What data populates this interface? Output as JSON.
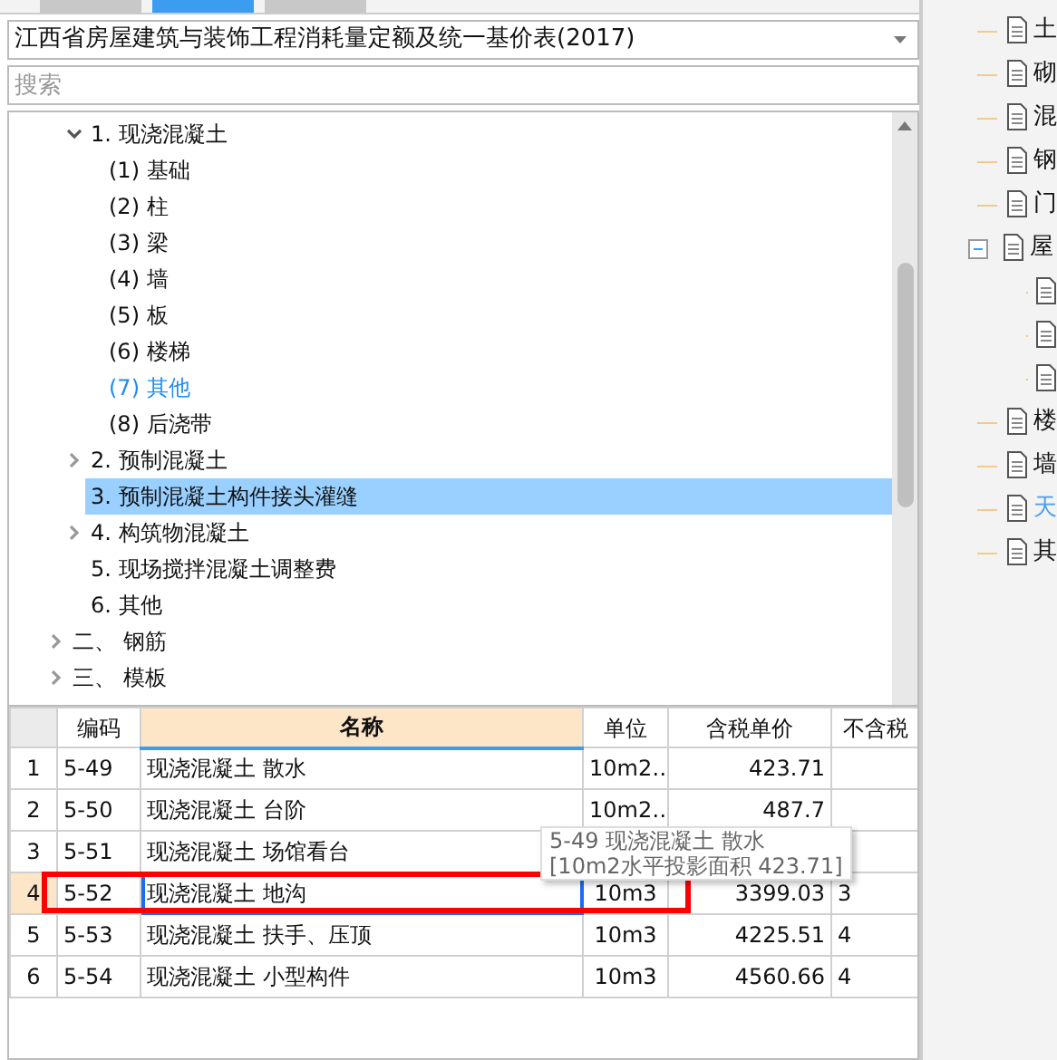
{
  "tabs": [
    {
      "selected": false
    },
    {
      "selected": true
    },
    {
      "selected": false
    }
  ],
  "library_select": {
    "value": "江西省房屋建筑与装饰工程消耗量定额及统一基价表(2017)"
  },
  "search": {
    "placeholder": "搜索"
  },
  "tree": {
    "items": [
      {
        "children": [
          {
            "label": "1. 现浇混凝土",
            "expanded": true,
            "selected": false,
            "active": false,
            "children": [
              {
                "label": "(1) 基础",
                "selected": false,
                "active": false
              },
              {
                "label": "(2) 柱",
                "selected": false,
                "active": false
              },
              {
                "label": "(3) 梁",
                "selected": false,
                "active": false
              },
              {
                "label": "(4) 墙",
                "selected": false,
                "active": false
              },
              {
                "label": "(5) 板",
                "selected": false,
                "active": false
              },
              {
                "label": "(6) 楼梯",
                "selected": false,
                "active": false
              },
              {
                "label": "(7) 其他",
                "selected": false,
                "active": true
              },
              {
                "label": "(8) 后浇带",
                "selected": false,
                "active": false
              }
            ]
          },
          {
            "label": "2. 预制混凝土",
            "expanded": false,
            "selected": false,
            "active": false
          },
          {
            "label": "3. 预制混凝土构件接头灌缝",
            "selected": true,
            "active": false
          },
          {
            "label": "4. 构筑物混凝土",
            "expanded": false,
            "selected": false,
            "active": false
          },
          {
            "label": "5. 现场搅拌混凝土调整费",
            "selected": false,
            "active": false
          },
          {
            "label": "6. 其他",
            "selected": false,
            "active": false
          }
        ]
      },
      {
        "label": "二、 钢筋",
        "expanded": false,
        "selected": false,
        "active": false
      },
      {
        "label": "三、 模板",
        "expanded": false,
        "selected": false,
        "active": false
      }
    ]
  },
  "table": {
    "columns": [
      {
        "active": false
      },
      {
        "label": "编码",
        "active": false
      },
      {
        "label": "名称",
        "active": true
      },
      {
        "label": "单位",
        "active": false
      },
      {
        "label": "含税单价",
        "active": false
      },
      {
        "label": "不含税",
        "active": false
      }
    ],
    "rows": [
      {
        "num": "1",
        "code": "5-49",
        "name": "现浇混凝土 散水",
        "unit": "10m2…",
        "price": "423.71",
        "selected": false
      },
      {
        "num": "2",
        "code": "5-50",
        "name": "现浇混凝土 台阶",
        "unit": "10m2…",
        "price": "487.7",
        "selected": false
      },
      {
        "num": "3",
        "code": "5-51",
        "name": "现浇混凝土 场馆看台",
        "selected": false
      },
      {
        "num": "4",
        "code": "5-52",
        "name": "现浇混凝土 地沟",
        "unit": "10m3",
        "price": "3399.03",
        "net": "3",
        "selected": true
      },
      {
        "num": "5",
        "code": "5-53",
        "name": "现浇混凝土 扶手、压顶",
        "unit": "10m3",
        "price": "4225.51",
        "net": "4",
        "selected": false
      },
      {
        "num": "6",
        "code": "5-54",
        "name": "现浇混凝土 小型构件",
        "unit": "10m3",
        "price": "4560.66",
        "net": "4",
        "selected": false
      }
    ]
  },
  "tooltip": {
    "lines": [
      "5-49 现浇混凝土 散水",
      "[10m2水平投影面积 423.71]"
    ]
  },
  "side_tree": {
    "items": [
      {
        "label": "土",
        "active": false
      },
      {
        "label": "砌",
        "active": false
      },
      {
        "label": "混",
        "active": false
      },
      {
        "label": "钢",
        "active": false
      },
      {
        "label": "门",
        "active": false
      },
      {
        "label": "屋",
        "active": false,
        "expanded": true,
        "children": [
          {
            "kind": "document"
          },
          {
            "kind": "document"
          },
          {
            "kind": "document"
          }
        ]
      },
      {
        "label": "楼",
        "active": false
      },
      {
        "label": "墙",
        "active": false
      },
      {
        "label": "天",
        "active": true
      },
      {
        "label": "其",
        "active": false
      }
    ]
  }
}
